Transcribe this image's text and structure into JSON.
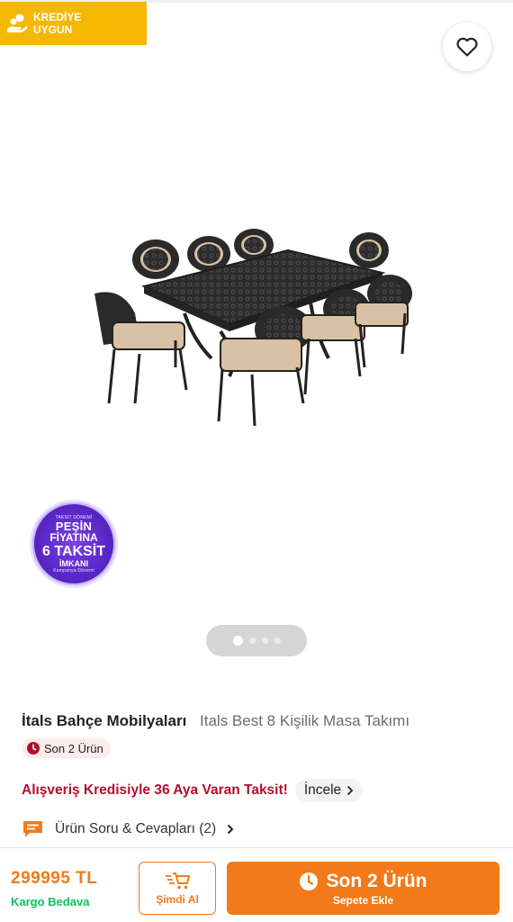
{
  "badge": {
    "text": "KREDİYE\nUYGUN",
    "icon": "coins-hand-icon",
    "color": "#f5b800"
  },
  "favorite": {
    "icon": "heart-outline-icon"
  },
  "gallery": {
    "image_alt": "Cast aluminium 8-person garden table set",
    "pager_dots": 4,
    "active_index": 0
  },
  "promo": {
    "small_top": "TAKSİT DÖNEMİ",
    "line1": "PEŞİN",
    "line2": "FİYATINA",
    "line3": "6 TAKSİT",
    "line4": "İMKANI",
    "small_bottom": "Kampanya Dönemi"
  },
  "product": {
    "brand": "İtals Bahçe Mobilyaları",
    "name": "Itals Best 8 Kişilik Masa Takımı"
  },
  "stock": {
    "label": "Son 2 Ürün",
    "icon": "clock-icon"
  },
  "credit": {
    "text": "Alışveriş Kredisiyle 36 Aya Varan Taksit!",
    "button": "İncele"
  },
  "qa": {
    "label": "Ürün Soru & Cevapları (2)",
    "icon": "chat-icon"
  },
  "checkout": {
    "price": "299995 TL",
    "shipping": "Kargo Bedava",
    "buy_now": "Şimdi Al",
    "add_cart_main": "Son 2 Ürün",
    "add_cart_sub": "Sepete Ekle",
    "accent": "#f27a1a",
    "shipping_color": "#0bc15c"
  }
}
